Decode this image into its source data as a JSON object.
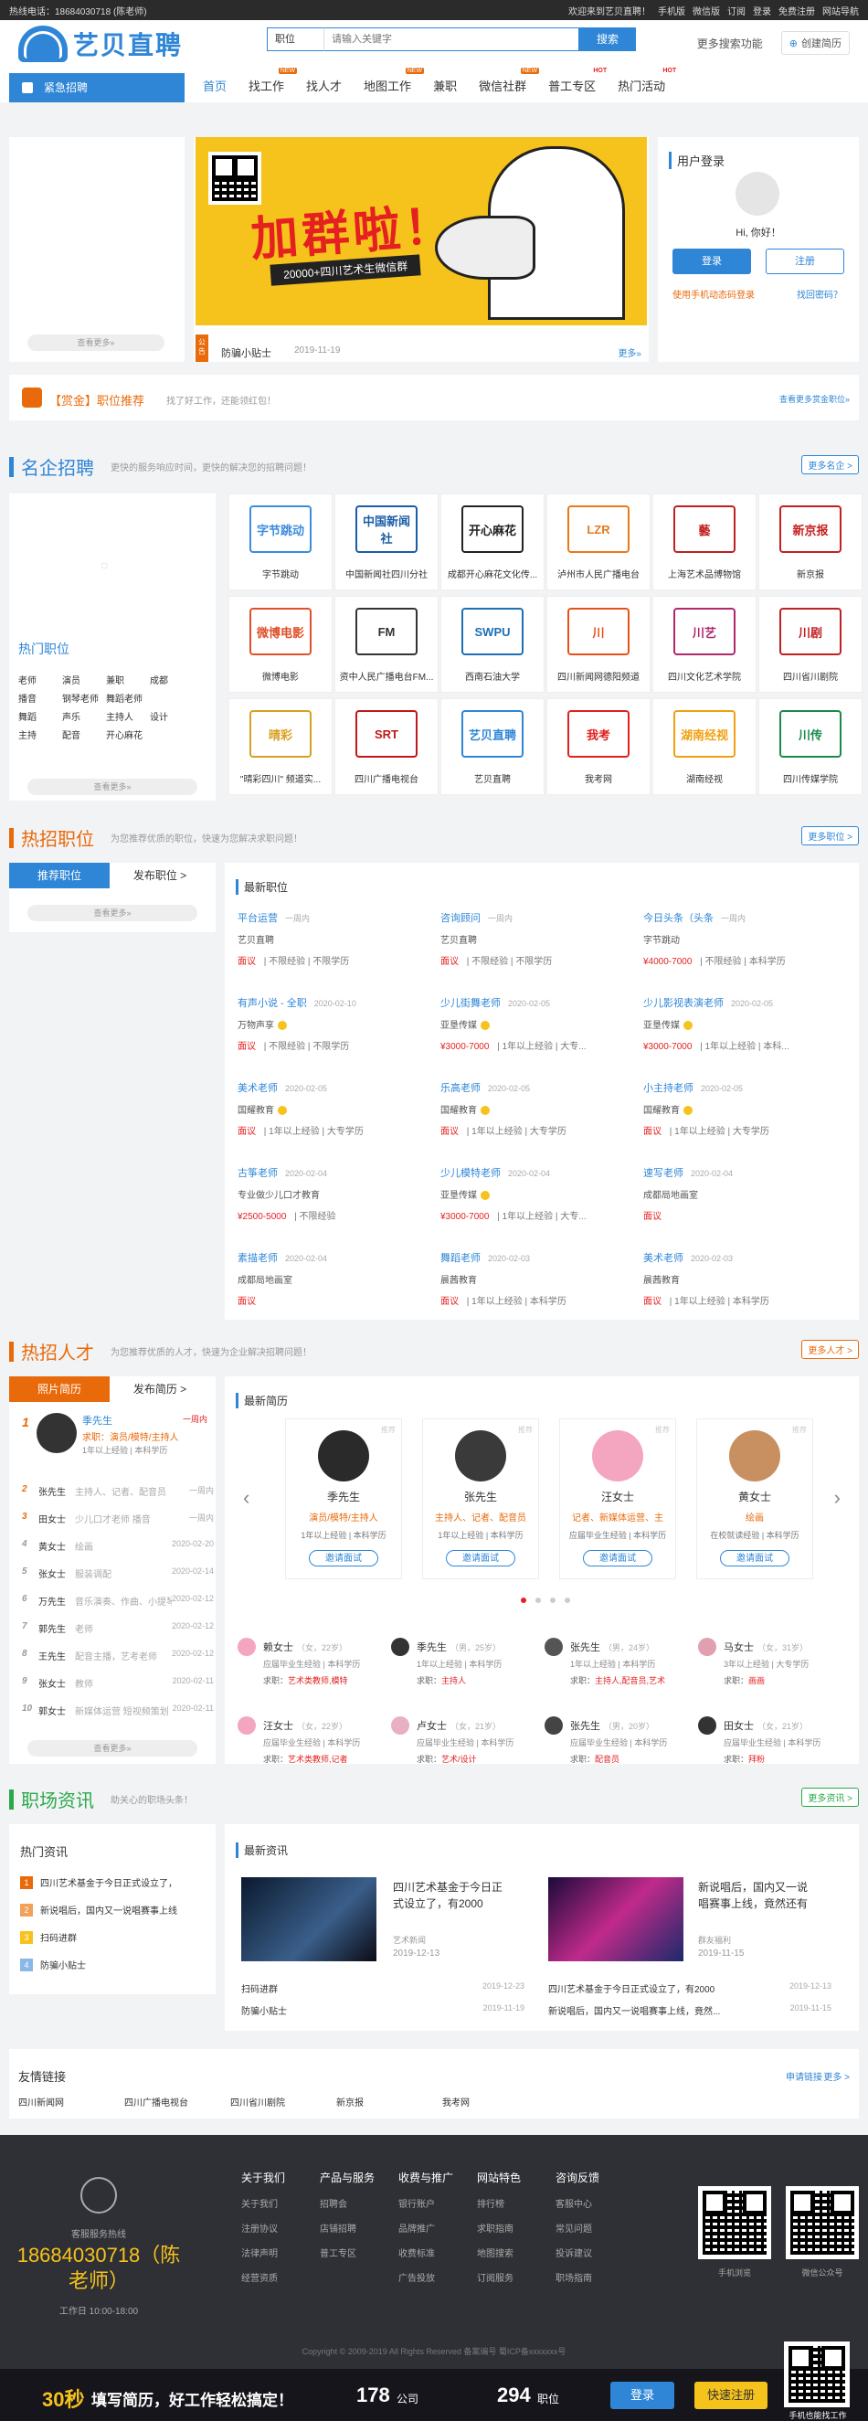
{
  "topbar": {
    "phone": "热线电话：18684030718 (陈老师)",
    "welcome": "欢迎来到艺贝直聘！",
    "mobile": "手机版",
    "wechat": "微信版",
    "subscribe": "订阅",
    "login": "登录",
    "register": "免费注册",
    "sitenav": "网站导航"
  },
  "header": {
    "logo": "艺贝直聘",
    "search_type": "职位",
    "search_placeholder": "请输入关键字",
    "search_button": "搜索",
    "more_search": "更多搜索功能",
    "create_resume": "创建简历"
  },
  "nav": {
    "category": "紧急招聘",
    "items": [
      {
        "label": "首页",
        "badge": ""
      },
      {
        "label": "找工作",
        "badge": "NEW"
      },
      {
        "label": "找人才",
        "badge": ""
      },
      {
        "label": "地图工作",
        "badge": "NEW"
      },
      {
        "label": "兼职",
        "badge": ""
      },
      {
        "label": "微信社群",
        "badge": "NEW"
      },
      {
        "label": "普工专区",
        "badge": "HOT"
      },
      {
        "label": "热门活动",
        "badge": "HOT"
      }
    ]
  },
  "left_urgent": {
    "more": "查看更多»"
  },
  "banner": {
    "title": "加群啦！",
    "subtitle": "20000+四川艺术生微信群",
    "notice_tag": "公告",
    "notice": "防骗小贴士",
    "notice_date": "2019-11-19",
    "notice_more": "更多»"
  },
  "login_box": {
    "title": "用户登录",
    "greeting": "Hi, 你好！",
    "login": "登录",
    "register": "注册",
    "phone_login": "使用手机动态码登录",
    "forgot": "找回密码？"
  },
  "bounty": {
    "title": "【赏金】职位推荐",
    "sub": "找了好工作，还能领红包！",
    "more": "查看更多赏金职位»"
  },
  "famous": {
    "title": "名企招聘",
    "sub": "更快的服务响应时间，更快的解决您的招聘问题！",
    "more": "更多名企 >",
    "hot_title": "热门职位",
    "hot_words": [
      "老师",
      "演员",
      "兼职",
      "成都",
      "播音",
      "钢琴老师",
      "舞蹈老师",
      "舞蹈",
      "声乐",
      "主持人",
      "设计",
      "主持",
      "配音",
      "开心麻花"
    ],
    "hot_more": "查看更多»",
    "companies": [
      {
        "name": "字节跳动",
        "logo": "字节跳动",
        "color": "#3c8cdc"
      },
      {
        "name": "中国新闻社四川分社",
        "logo": "中国新闻社",
        "color": "#1a5da8"
      },
      {
        "name": "成都开心麻花文化传...",
        "logo": "开心麻花",
        "color": "#222"
      },
      {
        "name": "泸州市人民广播电台",
        "logo": "LZR",
        "color": "#e87a1a"
      },
      {
        "name": "上海艺术品博物馆",
        "logo": "藝",
        "color": "#c02020"
      },
      {
        "name": "新京报",
        "logo": "新京报",
        "color": "#c42020"
      },
      {
        "name": "微博电影",
        "logo": "微博电影",
        "color": "#e0502a"
      },
      {
        "name": "资中人民广播电台FM...",
        "logo": "FM",
        "color": "#333"
      },
      {
        "name": "西南石油大学",
        "logo": "SWPU",
        "color": "#1c6fb5"
      },
      {
        "name": "四川新闻网德阳频道",
        "logo": "川",
        "color": "#e8501a"
      },
      {
        "name": "四川文化艺术学院",
        "logo": "川艺",
        "color": "#b0286a"
      },
      {
        "name": "四川省川剧院",
        "logo": "川剧",
        "color": "#c02020"
      },
      {
        "name": "\"晴彩四川\" 频道实...",
        "logo": "晴彩",
        "color": "#d8a020"
      },
      {
        "name": "四川广播电视台",
        "logo": "SRT",
        "color": "#c01818"
      },
      {
        "name": "艺贝直聘",
        "logo": "艺贝直聘",
        "color": "#2f86d6"
      },
      {
        "name": "我考网",
        "logo": "我考",
        "color": "#e02020"
      },
      {
        "name": "湖南经视",
        "logo": "湖南经视",
        "color": "#f0a010"
      },
      {
        "name": "四川传媒学院",
        "logo": "川传",
        "color": "#1a8a4a"
      }
    ]
  },
  "hotjobs": {
    "title": "热招职位",
    "sub": "为您推荐优质的职位，快速为您解决求职问题！",
    "more": "更多职位 >",
    "tab_rec": "推荐职位",
    "tab_post": "发布职位 >",
    "left_more": "查看更多»",
    "latest": "最新职位",
    "jobs": [
      {
        "title": "平台运营",
        "date": "一周内",
        "company": "艺贝直聘",
        "salary": "面议",
        "exp": "不限经验",
        "edu": "不限学历",
        "v": false
      },
      {
        "title": "咨询顾问",
        "date": "一周内",
        "company": "艺贝直聘",
        "salary": "面议",
        "exp": "不限经验",
        "edu": "不限学历",
        "v": false
      },
      {
        "title": "今日头条（头条",
        "date": "一周内",
        "company": "字节跳动",
        "salary": "¥4000-7000",
        "exp": "不限经验",
        "edu": "本科学历",
        "v": false
      },
      {
        "title": "有声小说 - 全职",
        "date": "2020-02-10",
        "company": "万物声享",
        "salary": "面议",
        "exp": "不限经验",
        "edu": "不限学历",
        "v": true
      },
      {
        "title": "少儿街舞老师",
        "date": "2020-02-05",
        "company": "亚垦传媒",
        "salary": "¥3000-7000",
        "exp": "1年以上经验",
        "edu": "大专...",
        "v": true
      },
      {
        "title": "少儿影视表演老师",
        "date": "2020-02-05",
        "company": "亚垦传媒",
        "salary": "¥3000-7000",
        "exp": "1年以上经验",
        "edu": "本科...",
        "v": true
      },
      {
        "title": "美术老师",
        "date": "2020-02-05",
        "company": "国耀教育",
        "salary": "面议",
        "exp": "1年以上经验",
        "edu": "大专学历",
        "v": true
      },
      {
        "title": "乐高老师",
        "date": "2020-02-05",
        "company": "国耀教育",
        "salary": "面议",
        "exp": "1年以上经验",
        "edu": "大专学历",
        "v": true
      },
      {
        "title": "小主持老师",
        "date": "2020-02-05",
        "company": "国耀教育",
        "salary": "面议",
        "exp": "1年以上经验",
        "edu": "大专学历",
        "v": true
      },
      {
        "title": "古筝老师",
        "date": "2020-02-04",
        "company": "专业做少儿口才教育",
        "salary": "¥2500-5000",
        "exp": "不限经验",
        "edu": "",
        "v": false
      },
      {
        "title": "少儿模特老师",
        "date": "2020-02-04",
        "company": "亚垦传媒",
        "salary": "¥3000-7000",
        "exp": "1年以上经验",
        "edu": "大专...",
        "v": true
      },
      {
        "title": "速写老师",
        "date": "2020-02-04",
        "company": "成都局地画室",
        "salary": "面议",
        "exp": "",
        "edu": "",
        "v": false
      },
      {
        "title": "素描老师",
        "date": "2020-02-04",
        "company": "成都局地画室",
        "salary": "面议",
        "exp": "",
        "edu": "",
        "v": false
      },
      {
        "title": "舞蹈老师",
        "date": "2020-02-03",
        "company": "晨茜教育",
        "salary": "面议",
        "exp": "1年以上经验",
        "edu": "本科学历",
        "v": false
      },
      {
        "title": "美术老师",
        "date": "2020-02-03",
        "company": "晨茜教育",
        "salary": "面议",
        "exp": "1年以上经验",
        "edu": "本科学历",
        "v": false
      }
    ]
  },
  "talent": {
    "title": "热招人才",
    "sub": "为您推荐优质的人才，快速为企业解决招聘问题！",
    "more": "更多人才 >",
    "tab_photo": "照片简历",
    "tab_post": "发布简历 >",
    "left_more": "查看更多»",
    "latest": "最新简历",
    "top": {
      "name": "季先生",
      "date": "一周内",
      "want": "求职：演员/模特/主持人",
      "info": "1年以上经验 | 本科学历"
    },
    "rank": [
      {
        "no": "2",
        "name": "张先生",
        "desc": "主持人、记者、配音员",
        "time": "一周内"
      },
      {
        "no": "3",
        "name": "田女士",
        "desc": "少儿口才老师 播音",
        "time": "一周内"
      },
      {
        "no": "4",
        "name": "黄女士",
        "desc": "绘画",
        "time": "2020-02-20"
      },
      {
        "no": "5",
        "name": "张女士",
        "desc": "服装调配",
        "time": "2020-02-14"
      },
      {
        "no": "6",
        "name": "万先生",
        "desc": "音乐演奏、作曲、小提琴",
        "time": "2020-02-12"
      },
      {
        "no": "7",
        "name": "郭先生",
        "desc": "老师",
        "time": "2020-02-12"
      },
      {
        "no": "8",
        "name": "王先生",
        "desc": "配音主播，艺考老师",
        "time": "2020-02-12"
      },
      {
        "no": "9",
        "name": "张女士",
        "desc": "教师",
        "time": "2020-02-11"
      },
      {
        "no": "10",
        "name": "郭女士",
        "desc": "新媒体运营 短视频策划",
        "time": "2020-02-11"
      }
    ],
    "cards": [
      {
        "name": "季先生",
        "pos": "演员/模特/主持人",
        "info": "1年以上经验 | 本科学历",
        "btn": "邀请面试",
        "tag": "推荐"
      },
      {
        "name": "张先生",
        "pos": "主持人、记者、配音员",
        "info": "1年以上经验 | 本科学历",
        "btn": "邀请面试",
        "tag": "推荐"
      },
      {
        "name": "汪女士",
        "pos": "记者、新媒体运营、主",
        "info": "应届毕业生经验 | 本科学历",
        "btn": "邀请面试",
        "tag": "推荐"
      },
      {
        "name": "黄女士",
        "pos": "绘画",
        "info": "在校就读经验 | 本科学历",
        "btn": "邀请面试",
        "tag": "推荐"
      }
    ],
    "mini": [
      {
        "name": "赖女士",
        "meta": "（女，22岁）",
        "info": "应届毕业生经验 | 本科学历",
        "want": "艺术类教师,模特"
      },
      {
        "name": "季先生",
        "meta": "（男，25岁）",
        "info": "1年以上经验 | 本科学历",
        "want": "主持人"
      },
      {
        "name": "张先生",
        "meta": "（男，24岁）",
        "info": "1年以上经验 | 本科学历",
        "want": "主持人,配音员,艺术"
      },
      {
        "name": "马女士",
        "meta": "（女，31岁）",
        "info": "3年以上经验 | 大专学历",
        "want": "画画"
      },
      {
        "name": "汪女士",
        "meta": "（女，22岁）",
        "info": "应届毕业生经验 | 本科学历",
        "want": "艺术类教师,记者"
      },
      {
        "name": "卢女士",
        "meta": "（女，21岁）",
        "info": "应届毕业生经验 | 本科学历",
        "want": "艺术/设计"
      },
      {
        "name": "张先生",
        "meta": "（男，20岁）",
        "info": "应届毕业生经验 | 本科学历",
        "want": "配音员"
      },
      {
        "name": "田女士",
        "meta": "（女，21岁）",
        "info": "应届毕业生经验 | 本科学历",
        "want": "拜粉"
      }
    ]
  },
  "news": {
    "title": "职场资讯",
    "sub": "助关心的职场头条！",
    "more": "更多资讯 >",
    "hot_title": "热门资讯",
    "hot": [
      "四川艺术基金于今日正式设立了，",
      "新说唱后，国内又一说唱赛事上线",
      "扫码进群",
      "防骗小贴士"
    ],
    "latest": "最新资讯",
    "feature": [
      {
        "title": "四川艺术基金于今日正式设立了，有2000",
        "src": "艺术新闻",
        "date": "2019-12-13"
      },
      {
        "title": "新说唱后，国内又一说唱赛事上线，竟然还有",
        "src": "群友福利",
        "date": "2019-11-15"
      }
    ],
    "list": [
      {
        "t": "扫码进群",
        "d": "2019-12-23"
      },
      {
        "t": "四川艺术基金于今日正式设立了，有2000",
        "d": "2019-12-13"
      },
      {
        "t": "防骗小贴士",
        "d": "2019-11-19"
      },
      {
        "t": "新说唱后，国内又一说唱赛事上线，竟然...",
        "d": "2019-11-15"
      }
    ]
  },
  "links": {
    "title": "友情链接",
    "apply": "申请链接",
    "more": "更多 >",
    "items": [
      "四川新闻网",
      "四川广播电视台",
      "四川省川剧院",
      "新京报",
      "我考网"
    ]
  },
  "footer": {
    "service": "客服服务热线",
    "phone": "18684030718（陈老师）",
    "hours": "工作日 10:00-18:00",
    "cols": [
      {
        "h": "关于我们",
        "items": [
          "关于我们",
          "注册协议",
          "法律声明",
          "经营资质"
        ]
      },
      {
        "h": "产品与服务",
        "items": [
          "招聘会",
          "店铺招聘",
          "普工专区"
        ]
      },
      {
        "h": "收费与推广",
        "items": [
          "银行账户",
          "品牌推广",
          "收费标准",
          "广告投放"
        ]
      },
      {
        "h": "网站特色",
        "items": [
          "排行榜",
          "求职指南",
          "地图搜索",
          "订阅服务"
        ]
      },
      {
        "h": "咨询反馈",
        "items": [
          "客服中心",
          "常见问题",
          "投诉建议",
          "职场指南"
        ]
      }
    ],
    "qr1": "手机浏览",
    "qr2": "微信公众号",
    "copyright": "Copyright © 2009-2019 All Rights Reserved 备案编号 蜀ICP备xxxxxxx号"
  },
  "bottombar": {
    "sec": "30秒",
    "slogan": "填写简历，好工作轻松搞定！",
    "companies": "178",
    "companies_label": "公司",
    "jobs": "294",
    "jobs_label": "职位",
    "login": "登录",
    "register": "快速注册",
    "qr": "手机也能找工作"
  }
}
